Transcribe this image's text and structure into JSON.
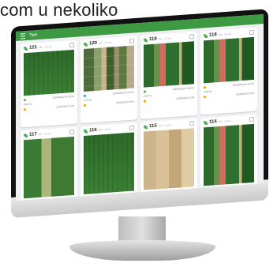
{
  "caption": "com u nekoliko",
  "app": {
    "title": "Tijek"
  },
  "cards": [
    {
      "id": "121",
      "sub": "Info · 1.5 ha",
      "texture": "f-green",
      "meta": [
        "12/04/2022 07:42:31",
        "5.91 ha",
        "11/05/2022 11:00"
      ],
      "dot_color": "#4caf50"
    },
    {
      "id": "120",
      "sub": "Info · 2.3 ha",
      "texture": "f-mosaic",
      "meta": [
        "12/04/2022 07:45:10",
        "1.21 ha",
        "11/05/2022 11:00"
      ],
      "dot_color": "#2196f3"
    },
    {
      "id": "119",
      "sub": "Info · 1.2 ha",
      "texture": "f-stripes",
      "meta": [
        "12/04/2022 07:48:02",
        "2.05 ha",
        "11/05/2022 11:00"
      ],
      "dot_color": "#4caf50"
    },
    {
      "id": "118",
      "sub": "Info · 3.4 ha",
      "texture": "f-stripes",
      "meta": [
        "12/04/2022 07:50:22",
        "0.96 ha",
        "11/05/2022 11:00"
      ],
      "dot_color": "#ff9800"
    },
    {
      "id": "117",
      "sub": "Info · 2.0 ha",
      "texture": "f-mixed",
      "meta": [],
      "dot_color": "#4caf50"
    },
    {
      "id": "116",
      "sub": "Info · 1.8 ha",
      "texture": "f-green",
      "meta": [],
      "dot_color": "#4caf50"
    },
    {
      "id": "115",
      "sub": "Info · 1.1 ha",
      "texture": "f-tan",
      "meta": [],
      "dot_color": "#4caf50"
    },
    {
      "id": "114",
      "sub": "Info · 2.6 ha",
      "texture": "f-stripes",
      "meta": [],
      "dot_color": "#4caf50"
    }
  ],
  "colors": {
    "topbar": "#3d9a43",
    "accent": "#4caf50"
  }
}
